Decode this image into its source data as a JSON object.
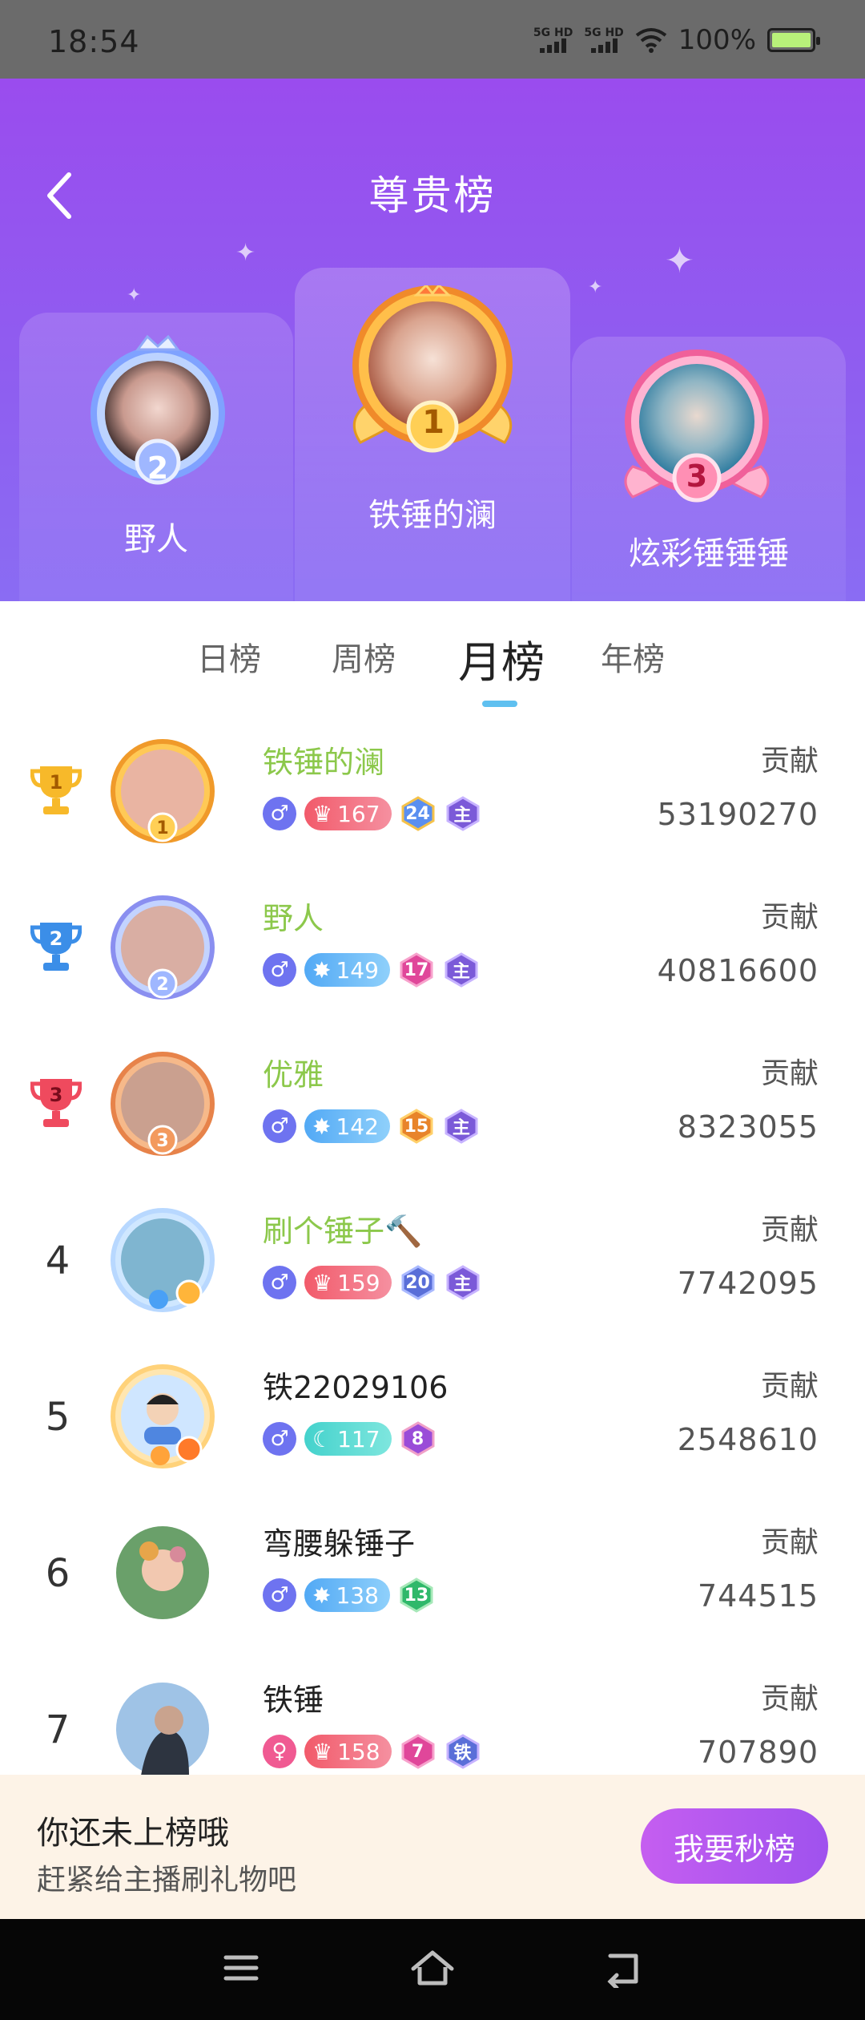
{
  "status": {
    "time": "18:54",
    "net1": "5G HD",
    "net2": "5G HD",
    "battery": "100%"
  },
  "header": {
    "title": "尊贵榜"
  },
  "podium": [
    {
      "rank": "2",
      "name": "野人"
    },
    {
      "rank": "1",
      "name": "铁锤的澜"
    },
    {
      "rank": "3",
      "name": "炫彩锤锤锤"
    }
  ],
  "tabs": [
    {
      "label": "日榜",
      "active": false
    },
    {
      "label": "周榜",
      "active": false
    },
    {
      "label": "月榜",
      "active": true
    },
    {
      "label": "年榜",
      "active": false
    }
  ],
  "list": [
    {
      "rank": "1",
      "name": "铁锤的澜",
      "gender": "♂",
      "level": "167",
      "fan": "24",
      "badge": "主",
      "contrib_label": "贡献",
      "contrib": "53190270"
    },
    {
      "rank": "2",
      "name": "野人",
      "gender": "♂",
      "level": "149",
      "fan": "17",
      "badge": "主",
      "contrib_label": "贡献",
      "contrib": "40816600"
    },
    {
      "rank": "3",
      "name": "优雅",
      "gender": "♂",
      "level": "142",
      "fan": "15",
      "badge": "主",
      "contrib_label": "贡献",
      "contrib": "8323055"
    },
    {
      "rank": "4",
      "name": "刷个锤子🔨",
      "gender": "♂",
      "level": "159",
      "fan": "20",
      "badge": "主",
      "contrib_label": "贡献",
      "contrib": "7742095"
    },
    {
      "rank": "5",
      "name": "铁22029106",
      "gender": "♂",
      "level": "117",
      "fan": "8",
      "badge": "",
      "contrib_label": "贡献",
      "contrib": "2548610"
    },
    {
      "rank": "6",
      "name": "弯腰躲锤子",
      "gender": "♂",
      "level": "138",
      "fan": "13",
      "badge": "",
      "contrib_label": "贡献",
      "contrib": "744515"
    },
    {
      "rank": "7",
      "name": "铁锤",
      "gender": "♀",
      "level": "158",
      "fan": "7",
      "badge": "铁",
      "contrib_label": "贡献",
      "contrib": "707890"
    }
  ],
  "banner": {
    "title": "你还未上榜哦",
    "subtitle": "赶紧给主播刷礼物吧",
    "cta": "我要秒榜"
  },
  "colors": {
    "header": "#9a4cee",
    "highlight_name": "#8cc84b",
    "tab_underline": "#5fc0f0",
    "cta": "#b259ef"
  }
}
